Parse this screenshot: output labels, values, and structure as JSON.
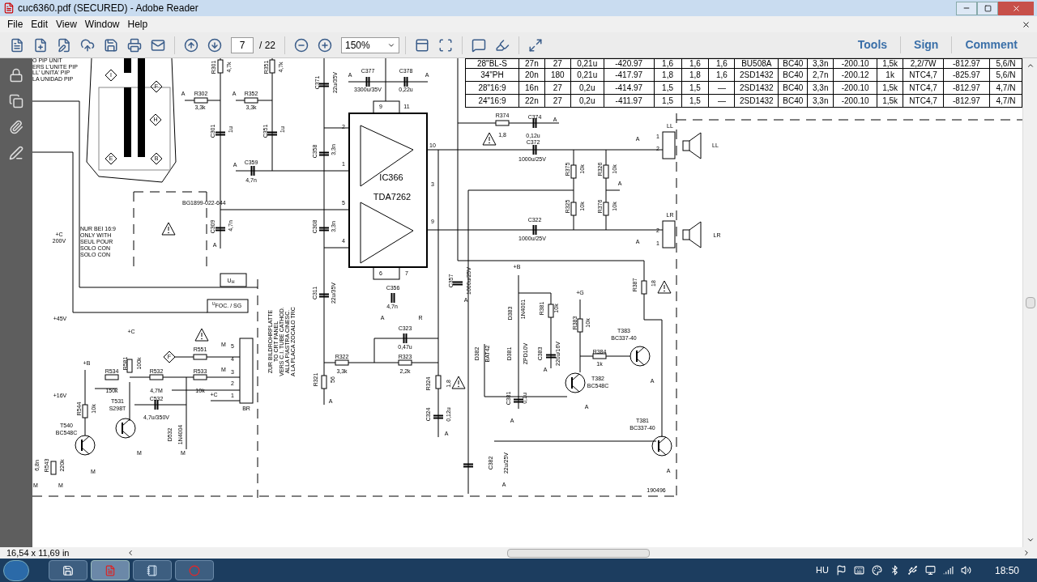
{
  "window": {
    "title": "cuc6360.pdf (SECURED) - Adobe Reader"
  },
  "menu": [
    "File",
    "Edit",
    "View",
    "Window",
    "Help"
  ],
  "toolbar": {
    "page": "7",
    "page_count": "/ 22",
    "zoom": "150%",
    "panes": [
      "Tools",
      "Sign",
      "Comment"
    ]
  },
  "document": {
    "table": {
      "rows": [
        [
          "28\"BL-S",
          "27n",
          "27",
          "0,21u",
          "-420.97",
          "1,6",
          "1,6",
          "1,6",
          "BU508A",
          "BC40",
          "3,3n",
          "-200.10",
          "1,5k",
          "2,2/7W",
          "-812.97",
          "5,6/N"
        ],
        [
          "34\"PH",
          "20n",
          "180",
          "0,21u",
          "-417.97",
          "1,8",
          "1,8",
          "1,6",
          "2SD1432",
          "BC40",
          "2,7n",
          "-200.12",
          "1k",
          "NTC4,7",
          "-825.97",
          "5,6/N"
        ],
        [
          "28\"16:9",
          "16n",
          "27",
          "0,2u",
          "-414.97",
          "1,5",
          "1,5",
          "—",
          "2SD1432",
          "BC40",
          "3,3n",
          "-200.10",
          "1,5k",
          "NTC4,7",
          "-812.97",
          "4,7/N"
        ],
        [
          "24\"16:9",
          "22n",
          "27",
          "0,2u",
          "-411.97",
          "1,5",
          "1,5",
          "—",
          "2SD1432",
          "BC40",
          "3,3n",
          "-200.10",
          "1,5k",
          "NTC4,7",
          "-812.97",
          "4,7/N"
        ]
      ]
    },
    "labels": [
      "O PIP UNIT",
      "ERS L'UNITE PIP",
      "LL' UNITA' PIP",
      "LA UNIDAD PIP",
      "I",
      "F",
      "H",
      "E",
      "B",
      "R301",
      "4,7k",
      "R351",
      "4,7k",
      "C377",
      "3300u/35V",
      "C378",
      "0,22u",
      "A",
      "A",
      "C371",
      "22u/35V",
      "A",
      "R302",
      "3,3k",
      "A",
      "R352",
      "3,3k",
      "9",
      "11",
      "C301",
      "1u",
      "C351",
      "1u",
      "2",
      "C358",
      "3,3n",
      "10",
      "A",
      "C359",
      "1",
      "4,7n",
      "IC366",
      "TDA7262",
      "3",
      "BG1899-022-644",
      "5",
      "NUR BEI 16:9",
      "ONLY WITH",
      "SEUL POUR",
      "SOLO CON",
      "SOLO CON",
      "+C",
      "200V",
      "C309",
      "4,7n",
      "C308",
      "3,3n",
      "9",
      "4",
      "A",
      "U$_{H}$",
      "6",
      "7",
      "C311",
      "22u/35V",
      "C356",
      "4,7n",
      "$^{U}$FOC. / SG",
      "+45V",
      "A",
      "R",
      "ZUR BILDROHRPLATTE",
      "TO CRT PANEL",
      "VERS C.I. TUBE CATHOD.",
      "ALLA PIASTRA CINESC.",
      "A LA PLACA ZOCALO TRC",
      "C323",
      "0,47u",
      "+C",
      "R551",
      "5",
      "4",
      "3",
      "2",
      "1",
      "M",
      "M",
      "F",
      "+B",
      "R581",
      "100k",
      "R322",
      "R323",
      "R534",
      "R532",
      "R533",
      "3,3k",
      "2,2k",
      "150k",
      "4,7M",
      "10k",
      "R321",
      "56",
      "R324",
      "1,8",
      "+16V",
      "+C",
      "C532",
      "T531",
      "A",
      "R544",
      "10k",
      "S298T",
      "BR",
      "4,7u/350V",
      "C324",
      "0,12u",
      "T540",
      "BC548C",
      "A",
      "D532",
      "1N4004",
      "M",
      "M",
      "6,8n",
      "R543",
      "220k",
      "M",
      "M",
      "M",
      "R374",
      "C374",
      "A",
      "LL",
      "1,8",
      "0,12u",
      "A",
      "1",
      "C372",
      "LL",
      "2",
      "1000u/25V",
      "R375",
      "10k",
      "R326",
      "10k",
      "A",
      "R325",
      "10k",
      "R376",
      "10k",
      "LR",
      "C322",
      "2",
      "LR",
      "1000u/25V",
      "A",
      "1",
      "+B",
      "C357",
      "1000u/25V",
      "R387",
      "18",
      "+G",
      "A",
      "D383",
      "1N4001",
      "R381",
      "10k",
      "R383",
      "10k",
      "T383",
      "BC337-40",
      "D382",
      "BAT42",
      "D381",
      "ZPD10V",
      "C383",
      "220u/16V",
      "R384",
      "1k",
      "A",
      "T382",
      "BC548C",
      "A",
      "C381",
      "0,1u",
      "A",
      "A",
      "T381",
      "BC337-40",
      "C382",
      "22u/25V",
      "A",
      "A",
      "190496"
    ]
  },
  "status_bar": {
    "page_size": "16,54 x 11,69 in"
  },
  "taskbar": {
    "language": "HU",
    "clock": "18:50"
  }
}
